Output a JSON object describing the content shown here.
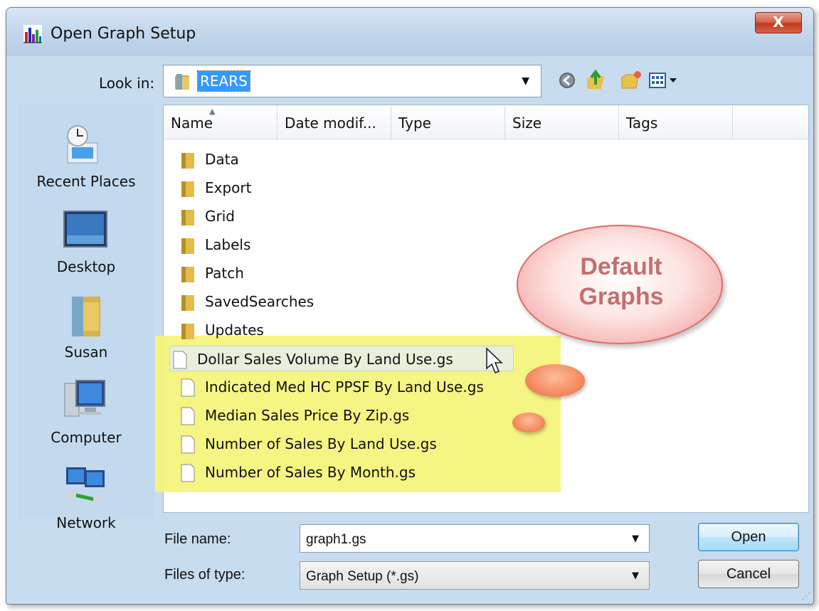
{
  "window": {
    "title": "Open Graph Setup",
    "close_label": "X"
  },
  "toolbar": {
    "look_in_label": "Look in:",
    "look_in_value": "REARS",
    "buttons": [
      "back-icon",
      "up-folder-icon",
      "new-folder-icon",
      "views-menu-icon"
    ]
  },
  "places": [
    {
      "label": "Recent Places",
      "icon": "recent-places-icon"
    },
    {
      "label": "Desktop",
      "icon": "desktop-icon"
    },
    {
      "label": "Susan",
      "icon": "user-folder-icon"
    },
    {
      "label": "Computer",
      "icon": "computer-icon"
    },
    {
      "label": "Network",
      "icon": "network-icon"
    }
  ],
  "columns": [
    "Name",
    "Date modif...",
    "Type",
    "Size",
    "Tags"
  ],
  "folders": [
    "Data",
    "Export",
    "Grid",
    "Labels",
    "Patch",
    "SavedSearches",
    "Updates"
  ],
  "files": [
    "Dollar Sales Volume By Land Use.gs",
    "Indicated Med HC PPSF By Land Use.gs",
    "Median Sales Price By Zip.gs",
    "Number of Sales By Land Use.gs",
    "Number of Sales By Month.gs"
  ],
  "callout": {
    "line1": "Default",
    "line2": "Graphs"
  },
  "bottom": {
    "file_name_label": "File name:",
    "file_name_value": "graph1.gs",
    "file_type_label": "Files of type:",
    "file_type_value": "Graph Setup (*.gs)",
    "open_label": "Open",
    "cancel_label": "Cancel"
  },
  "colors": {
    "highlight": "#f4f478",
    "selection": "#3399ff",
    "callout_text": "#c17070",
    "accent_blob": "#f4875c"
  }
}
